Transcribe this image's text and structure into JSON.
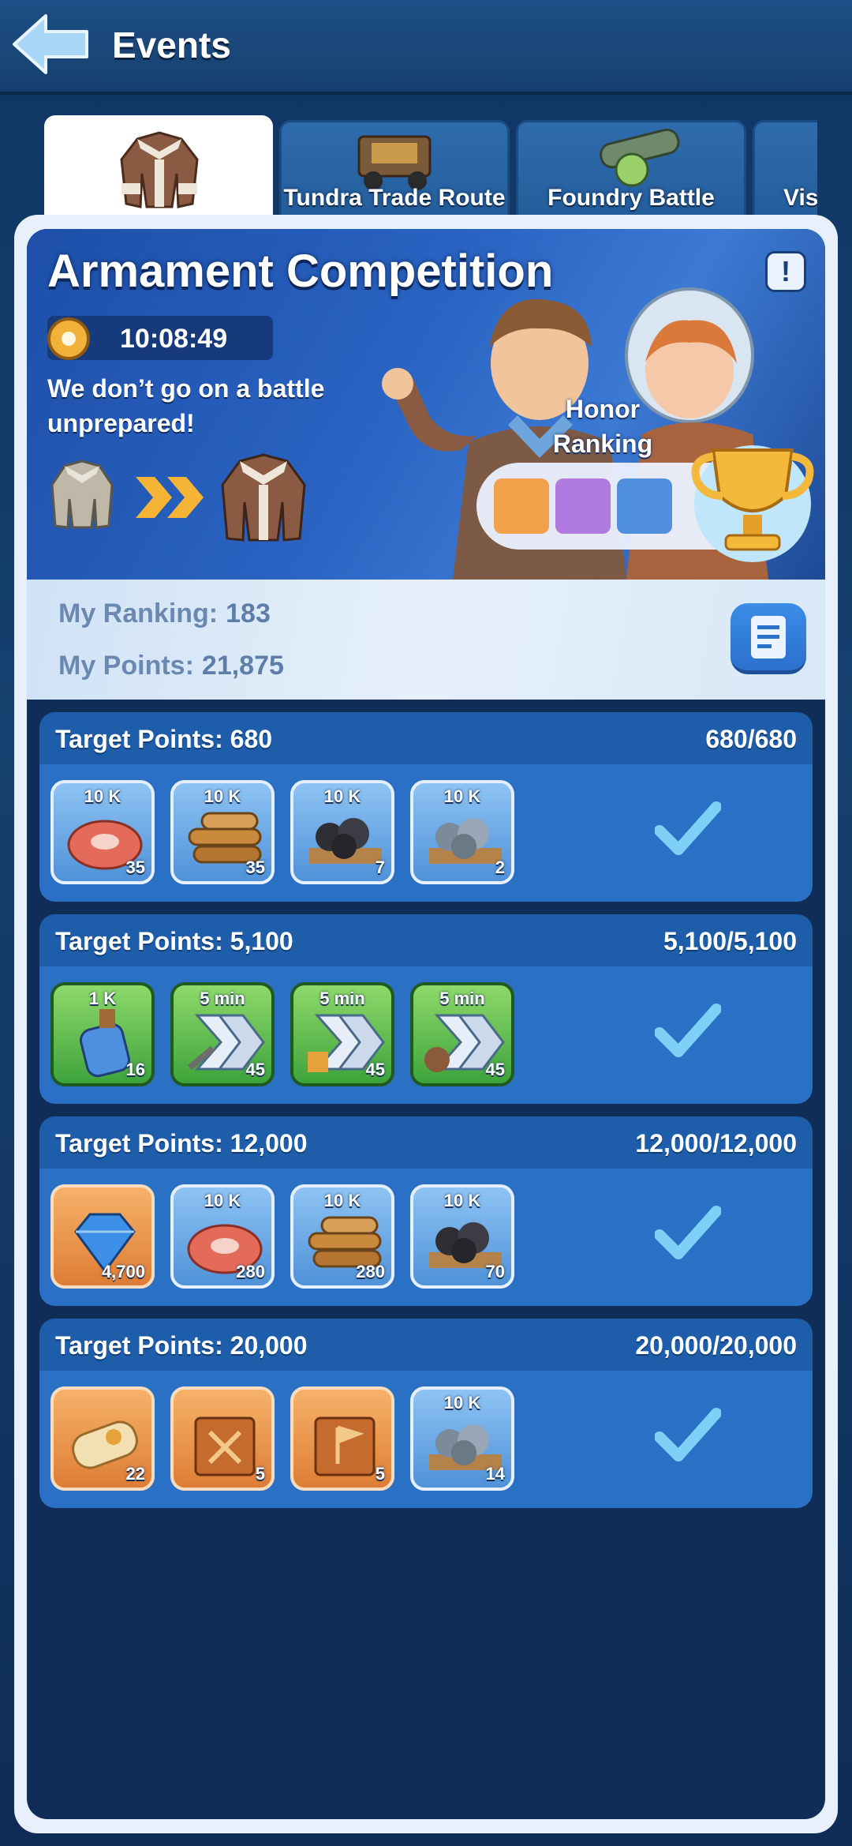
{
  "header": {
    "title": "Events"
  },
  "tabs": [
    {
      "label": "",
      "icon": "fur-coat-icon",
      "active": true
    },
    {
      "label": "Tundra Trade Route",
      "icon": "truck-icon",
      "active": false
    },
    {
      "label": "Foundry Battle",
      "icon": "cannon-icon",
      "active": false
    },
    {
      "label": "Vis",
      "icon": "",
      "active": false
    }
  ],
  "banner": {
    "title": "Armament Competition",
    "timer": "10:08:49",
    "description": "We don’t go on a battle unprepared!",
    "honor_label": "Honor Ranking"
  },
  "ranking": {
    "rank_label": "My Ranking:",
    "rank_value": "183",
    "points_label": "My Points:",
    "points_value": "21,875"
  },
  "targets": [
    {
      "label": "Target Points: 680",
      "progress": "680/680",
      "completed": true,
      "rewards": [
        {
          "type": "meat",
          "top": "10 K",
          "count": "35",
          "frame": "blue"
        },
        {
          "type": "wood",
          "top": "10 K",
          "count": "35",
          "frame": "blue"
        },
        {
          "type": "coal",
          "top": "10 K",
          "count": "7",
          "frame": "blue"
        },
        {
          "type": "iron",
          "top": "10 K",
          "count": "2",
          "frame": "blue"
        }
      ]
    },
    {
      "label": "Target Points: 5,100",
      "progress": "5,100/5,100",
      "completed": true,
      "rewards": [
        {
          "type": "exp-potion",
          "top": "1 K",
          "count": "16",
          "frame": "green"
        },
        {
          "type": "speedup-training",
          "top": "5 min",
          "count": "45",
          "frame": "green"
        },
        {
          "type": "speedup-construction",
          "top": "5 min",
          "count": "45",
          "frame": "green"
        },
        {
          "type": "speedup-hero",
          "top": "5 min",
          "count": "45",
          "frame": "green"
        }
      ]
    },
    {
      "label": "Target Points: 12,000",
      "progress": "12,000/12,000",
      "completed": true,
      "rewards": [
        {
          "type": "gems",
          "top": "",
          "count": "4,700",
          "frame": "orange"
        },
        {
          "type": "meat",
          "top": "10 K",
          "count": "280",
          "frame": "blue"
        },
        {
          "type": "wood",
          "top": "10 K",
          "count": "280",
          "frame": "blue"
        },
        {
          "type": "coal",
          "top": "10 K",
          "count": "70",
          "frame": "blue"
        }
      ]
    },
    {
      "label": "Target Points: 20,000",
      "progress": "20,000/20,000",
      "completed": true,
      "rewards": [
        {
          "type": "scroll",
          "top": "",
          "count": "22",
          "frame": "orange"
        },
        {
          "type": "book-crossed-swords",
          "top": "",
          "count": "5",
          "frame": "orange"
        },
        {
          "type": "book-flag",
          "top": "",
          "count": "5",
          "frame": "orange"
        },
        {
          "type": "iron",
          "top": "10 K",
          "count": "14",
          "frame": "blue"
        }
      ]
    }
  ],
  "colors": {
    "accent": "#2a70c4",
    "check": "#7fd0f7",
    "gold": "#f2b23a"
  }
}
